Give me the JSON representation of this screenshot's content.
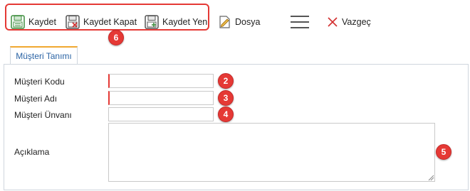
{
  "toolbar": {
    "save_label": "Kaydet",
    "save_close_label": "Kaydet Kapat",
    "save_new_label": "Kaydet Yeni",
    "file_label": "Dosya",
    "cancel_label": "Vazgeç"
  },
  "tabs": [
    {
      "label": "Müşteri Tanımı"
    }
  ],
  "form": {
    "customer_code_label": "Müşteri Kodu",
    "customer_name_label": "Müşteri Adı",
    "customer_title_label": "Müşteri Ünvanı",
    "description_label": "Açıklama",
    "customer_code_value": "",
    "customer_name_value": "",
    "customer_title_value": "",
    "description_value": ""
  },
  "callouts": {
    "b2": "2",
    "b3": "3",
    "b4": "4",
    "b5": "5",
    "b6": "6"
  },
  "colors": {
    "accent_red": "#e53935",
    "tab_top": "#f0a830",
    "tab_text": "#2a63a4",
    "save_icon": "#3e8e3e"
  }
}
